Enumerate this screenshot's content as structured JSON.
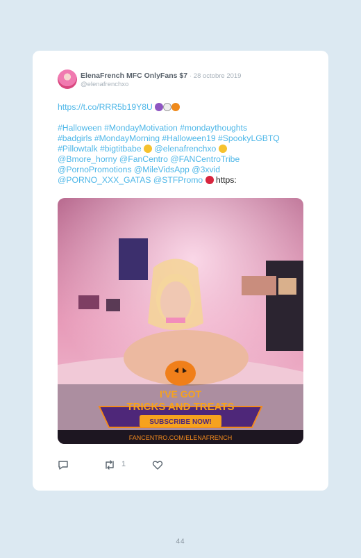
{
  "tweet": {
    "author_name": "ElenaFrench MFC OnlyFans $7",
    "date": "28 octobre 2019",
    "handle": "@elenafrenchxo",
    "link": "https://t.co/RRR5b19Y8U",
    "lines": {
      "l1": "#Halloween #MondayMotivation #mondaythoughts",
      "l2": "#badgirls #MondayMorning #Halloween19 #SpookyLGBTQ",
      "l3a": "#Pillowtalk #bigtitbabe",
      "l3b": "@elenafrenchxo",
      "l4": "@Bmore_horny @FanCentro @FANCentroTribe",
      "l5": "@PornoPromotions @MileVidsApp @3xvid",
      "l6": "@PORNO_XXX_GATAS @STFPromo",
      "l6_tail": "https:"
    },
    "retweet_count": "1"
  },
  "media": {
    "banner_line1": "I'VE GOT",
    "banner_line2": "TRICKS AND TREATS",
    "banner_cta": "SUBSCRIBE NOW!",
    "banner_url": "FANCENTRO.COM/ELENAFRENCH"
  },
  "icons": [
    "reply-icon",
    "retweet-icon",
    "like-icon",
    "devil-emoji",
    "ghost-emoji",
    "pumpkin-emoji",
    "star-eyes-emoji",
    "kiss-emoji"
  ],
  "colors": {
    "link": "#4eb7e8",
    "background": "#dce9f2",
    "card": "#ffffff"
  },
  "page_number": "44"
}
